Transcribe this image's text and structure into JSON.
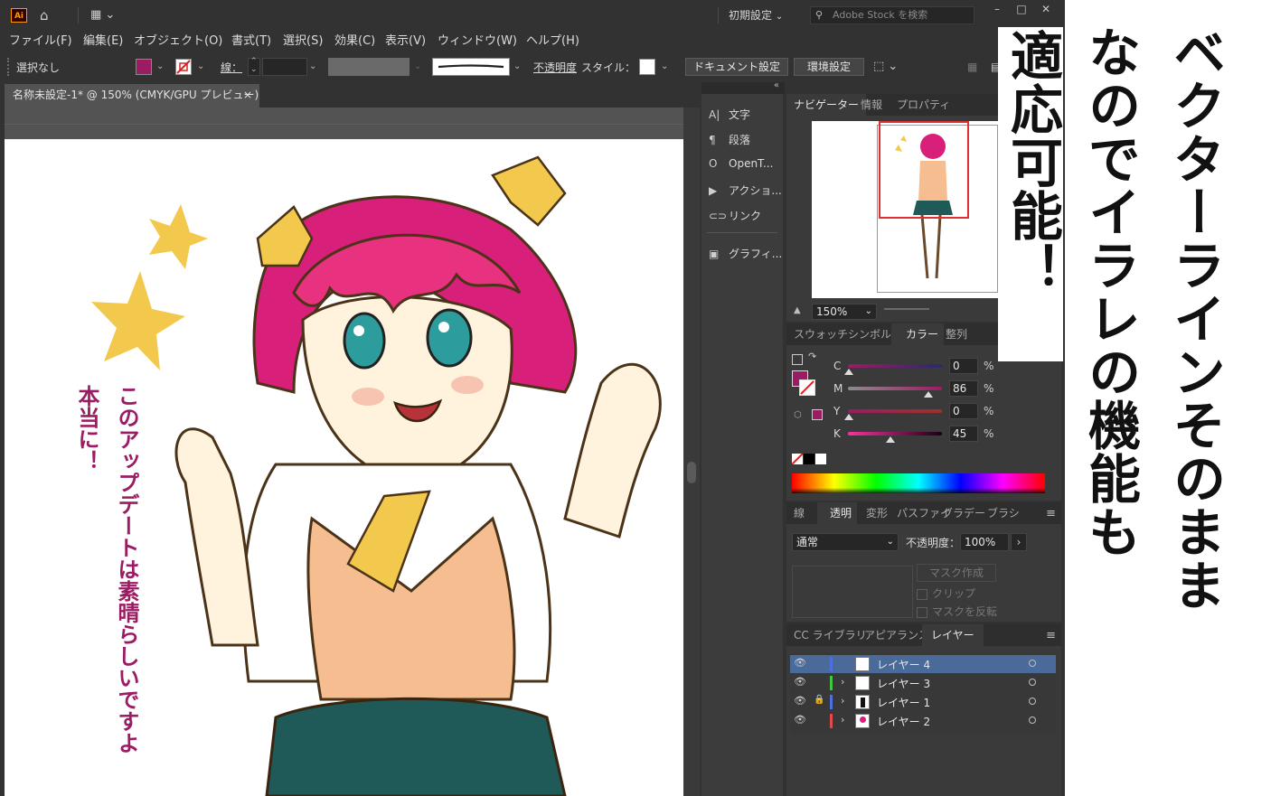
{
  "app": {
    "logo_text": "Ai",
    "workspace_preset": "初期設定",
    "search_placeholder": "Adobe Stock を検索",
    "window_buttons": [
      "–",
      "□",
      "✕"
    ]
  },
  "menu": [
    "ファイル(F)",
    "編集(E)",
    "オブジェクト(O)",
    "書式(T)",
    "選択(S)",
    "効果(C)",
    "表示(V)",
    "ウィンドウ(W)",
    "ヘルプ(H)"
  ],
  "control_bar": {
    "selection_status": "選択なし",
    "fill_color": "#9b1c63",
    "stroke_label": "線：",
    "opacity_label": "不透明度",
    "style_label": "スタイル：",
    "document_settings": "ドキュメント設定",
    "preferences": "環境設定"
  },
  "document_tab": {
    "title": "名称未設定-1* @ 150% (CMYK/GPU プレビュー)",
    "close": "×"
  },
  "canvas_text": {
    "vertical_main": "このアップデートは素晴らしいですよ",
    "vertical_side": "本当に！",
    "text_color": "#9b1c63"
  },
  "dock": {
    "items": [
      {
        "icon": "A|",
        "label": "文字"
      },
      {
        "icon": "¶",
        "label": "段落"
      },
      {
        "icon": "O",
        "label": "OpenT..."
      },
      {
        "icon": "▶",
        "label": "アクショ..."
      },
      {
        "icon": "⊂⊃",
        "label": "リンク"
      },
      {
        "icon": "▣",
        "label": "グラフィ..."
      }
    ]
  },
  "navigator_panel": {
    "tabs": [
      "ナビゲーター",
      "情報",
      "プロパティ"
    ],
    "zoom": "150%"
  },
  "color_panel": {
    "tabs": [
      "スウォッチ",
      "シンボル",
      "カラー",
      "整列"
    ],
    "channels": [
      {
        "label": "C",
        "value": "0"
      },
      {
        "label": "M",
        "value": "86"
      },
      {
        "label": "Y",
        "value": "0"
      },
      {
        "label": "K",
        "value": "45"
      }
    ],
    "unit": "%",
    "current_color": "#9b1c63"
  },
  "transparency_panel": {
    "tabs": [
      "線",
      "透明",
      "変形",
      "パスファイ",
      "グラデー",
      "ブラシ"
    ],
    "blend_mode": "通常",
    "opacity_label": "不透明度：",
    "opacity_value": "100%",
    "make_mask": "マスク作成",
    "clip": "クリップ",
    "invert_mask": "マスクを反転"
  },
  "layers_panel": {
    "tabs": [
      "CC ライブラリ",
      "アピアランス",
      "レイヤー"
    ],
    "layers": [
      {
        "name": "レイヤー 4",
        "color": "#4f6ee0",
        "selected": true,
        "locked": false,
        "expandable": false
      },
      {
        "name": "レイヤー 3",
        "color": "#43c443",
        "selected": false,
        "locked": false,
        "expandable": true
      },
      {
        "name": "レイヤー 1",
        "color": "#4f6ee0",
        "selected": false,
        "locked": true,
        "expandable": true
      },
      {
        "name": "レイヤー 2",
        "color": "#e04a4a",
        "selected": false,
        "locked": false,
        "expandable": true
      }
    ]
  },
  "overlay": {
    "column_right": "ベクターラインそのまま",
    "column_middle": "なのでイラレの機能も",
    "column_left": "適応可能！"
  }
}
